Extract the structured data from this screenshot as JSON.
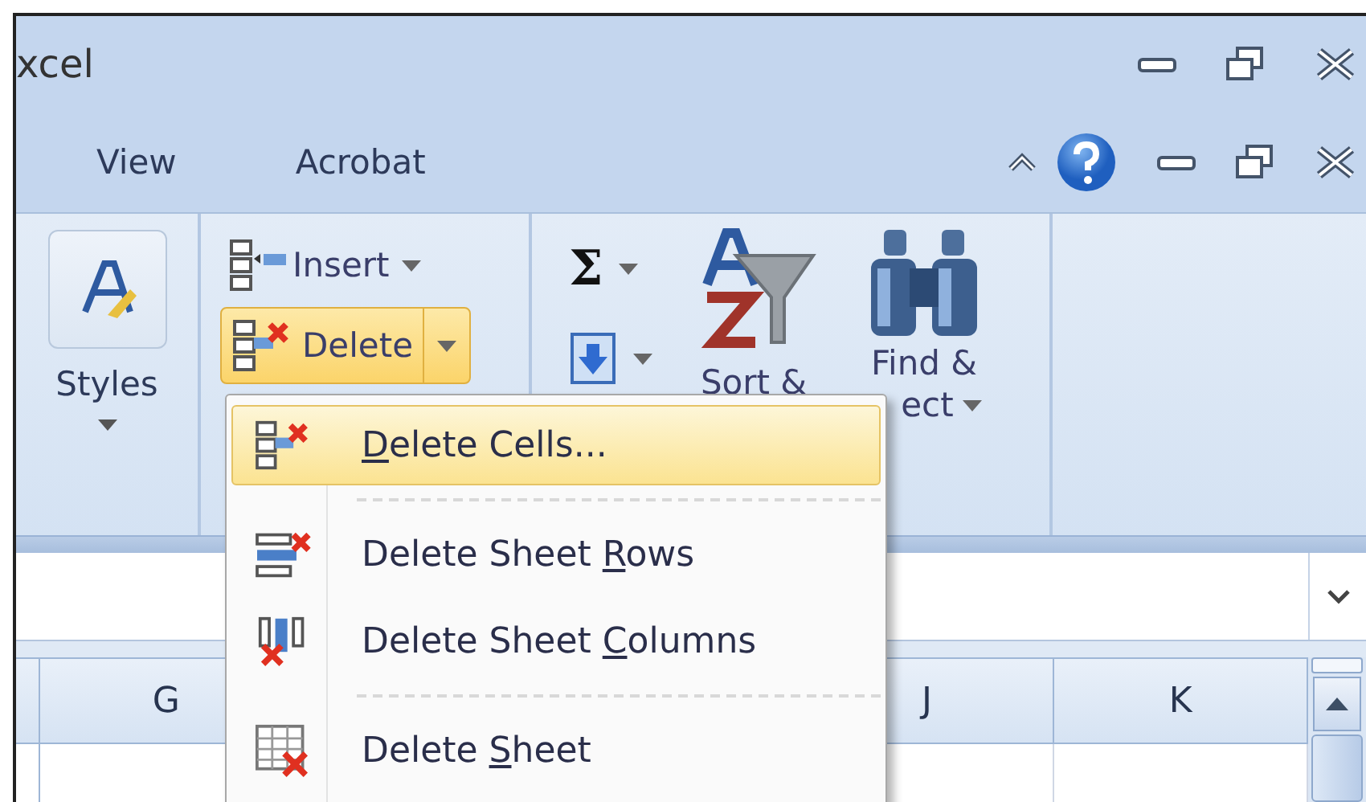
{
  "window": {
    "title": "xcel"
  },
  "tabs": [
    {
      "label": "View",
      "selected": false
    },
    {
      "label": "Acrobat",
      "selected": false
    }
  ],
  "ribbon": {
    "styles": {
      "label": "Styles"
    },
    "cells": {
      "insert": "Insert",
      "delete": {
        "label": "Delete",
        "pressed": true
      }
    },
    "editing": {
      "sum": "Σ",
      "sort_label": "Sort &",
      "find_label": "Find &",
      "select_label": "ect"
    }
  },
  "delete_menu": {
    "items": [
      {
        "kind": "cells",
        "key": "D",
        "post": "elete Cells...",
        "selected": true,
        "separator_above": false
      },
      {
        "kind": "rows",
        "pre": "Delete Sheet ",
        "key": "R",
        "post": "ows",
        "selected": false,
        "separator_above": true
      },
      {
        "kind": "columns",
        "pre": "Delete Sheet ",
        "key": "C",
        "post": "olumns",
        "selected": false,
        "separator_above": false
      },
      {
        "kind": "sheet",
        "pre": "Delete ",
        "key": "S",
        "post": "heet",
        "selected": false,
        "separator_above": true
      }
    ]
  },
  "columns": [
    "G",
    "J",
    "K"
  ]
}
